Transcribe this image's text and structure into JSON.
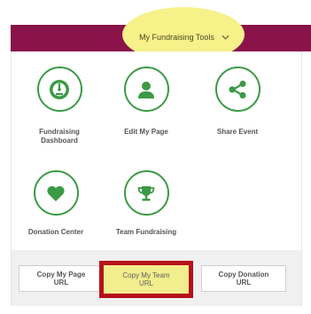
{
  "header": {
    "tools_label": "My Fundraising Tools",
    "tools_icon": "chevron-down-icon"
  },
  "tools": [
    {
      "label": "Fundraising\nDashboard",
      "icon": "speedometer-icon"
    },
    {
      "label": "Edit My Page",
      "icon": "person-icon"
    },
    {
      "label": "Share Event",
      "icon": "share-icon"
    },
    {
      "label": "Donation Center",
      "icon": "heart-icon"
    },
    {
      "label": "Team Fundraising",
      "icon": "trophy-icon"
    }
  ],
  "copy_buttons": {
    "page": "Copy My Page\nURL",
    "team": "Copy My Team\nURL",
    "donation": "Copy Donation\nURL"
  },
  "colors": {
    "nav_bar": "#8a1449",
    "icon_green": "#3b9a45",
    "highlight_yellow": "#f6f189",
    "highlight_border_red": "#b5121b"
  }
}
